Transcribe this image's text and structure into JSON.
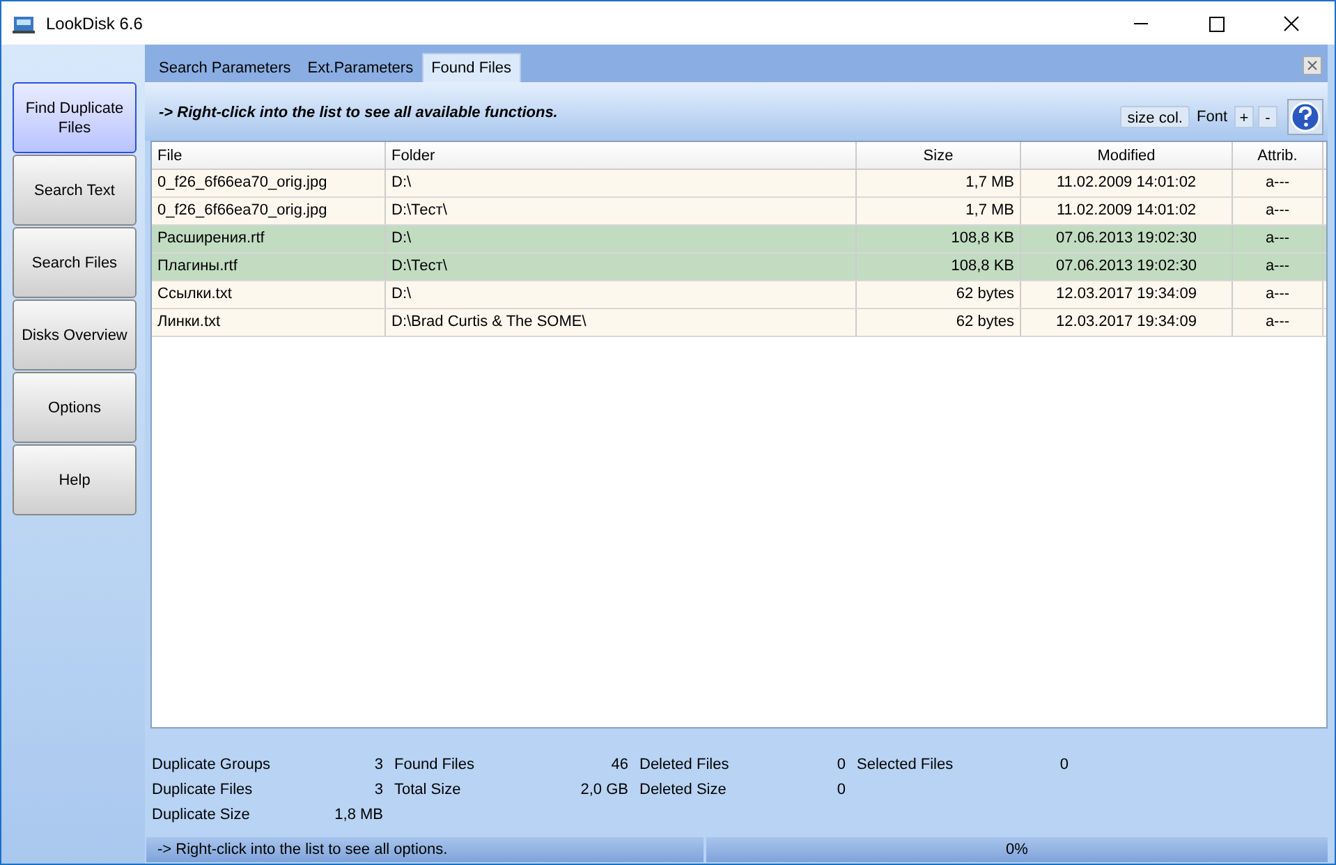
{
  "window": {
    "title": "LookDisk 6.6"
  },
  "sidebar": {
    "items": [
      {
        "label": "Find Duplicate Files",
        "selected": true
      },
      {
        "label": "Search Text",
        "selected": false
      },
      {
        "label": "Search Files",
        "selected": false
      },
      {
        "label": "Disks Overview",
        "selected": false
      },
      {
        "label": "Options",
        "selected": false
      },
      {
        "label": "Help",
        "selected": false
      }
    ]
  },
  "tabs": [
    {
      "label": "Search Parameters",
      "selected": false
    },
    {
      "label": "Ext.Parameters",
      "selected": false
    },
    {
      "label": "Found Files",
      "selected": true
    }
  ],
  "toolbar": {
    "hint": "-> Right-click into the list to see all available functions.",
    "size_button": "size col.",
    "font_label": "Font",
    "font_plus": "+",
    "font_minus": "-"
  },
  "table": {
    "columns": [
      "File",
      "Folder",
      "Size",
      "Modified",
      "Attrib."
    ],
    "rows": [
      {
        "cells": [
          "0_f26_6f66ea70_orig.jpg",
          "D:\\",
          "1,7 MB",
          "11.02.2009 14:01:02",
          "a---"
        ],
        "color": "#fdf8ee"
      },
      {
        "cells": [
          "0_f26_6f66ea70_orig.jpg",
          "D:\\Тест\\",
          "1,7 MB",
          "11.02.2009 14:01:02",
          "a---"
        ],
        "color": "#fdf8ee"
      },
      {
        "cells": [
          "Расширения.rtf",
          "D:\\",
          "108,8 KB",
          "07.06.2013 19:02:30",
          "a---"
        ],
        "color": "#c2dcc2"
      },
      {
        "cells": [
          "Плагины.rtf",
          "D:\\Тест\\",
          "108,8 KB",
          "07.06.2013 19:02:30",
          "a---"
        ],
        "color": "#c2dcc2"
      },
      {
        "cells": [
          "Ссылки.txt",
          "D:\\",
          "62 bytes",
          "12.03.2017 19:34:09",
          "a---"
        ],
        "color": "#fdf8ee"
      },
      {
        "cells": [
          "Линки.txt",
          "D:\\Brad Curtis & The SOME\\",
          "62 bytes",
          "12.03.2017 19:34:09",
          "a---"
        ],
        "color": "#fdf8ee"
      }
    ]
  },
  "stats": [
    [
      {
        "label": "Duplicate Groups",
        "value": "3"
      },
      {
        "label": "Duplicate Files",
        "value": "3"
      },
      {
        "label": "Duplicate Size",
        "value": "1,8 MB"
      }
    ],
    [
      {
        "label": "Found Files",
        "value": "46"
      },
      {
        "label": "Total Size",
        "value": "2,0 GB"
      }
    ],
    [
      {
        "label": "Deleted Files",
        "value": "0"
      },
      {
        "label": "Deleted Size",
        "value": "0"
      }
    ],
    [
      {
        "label": "Selected Files",
        "value": "0"
      }
    ]
  ],
  "status_bar": {
    "message": "-> Right-click into the list to see all options.",
    "progress_text": "0%"
  }
}
